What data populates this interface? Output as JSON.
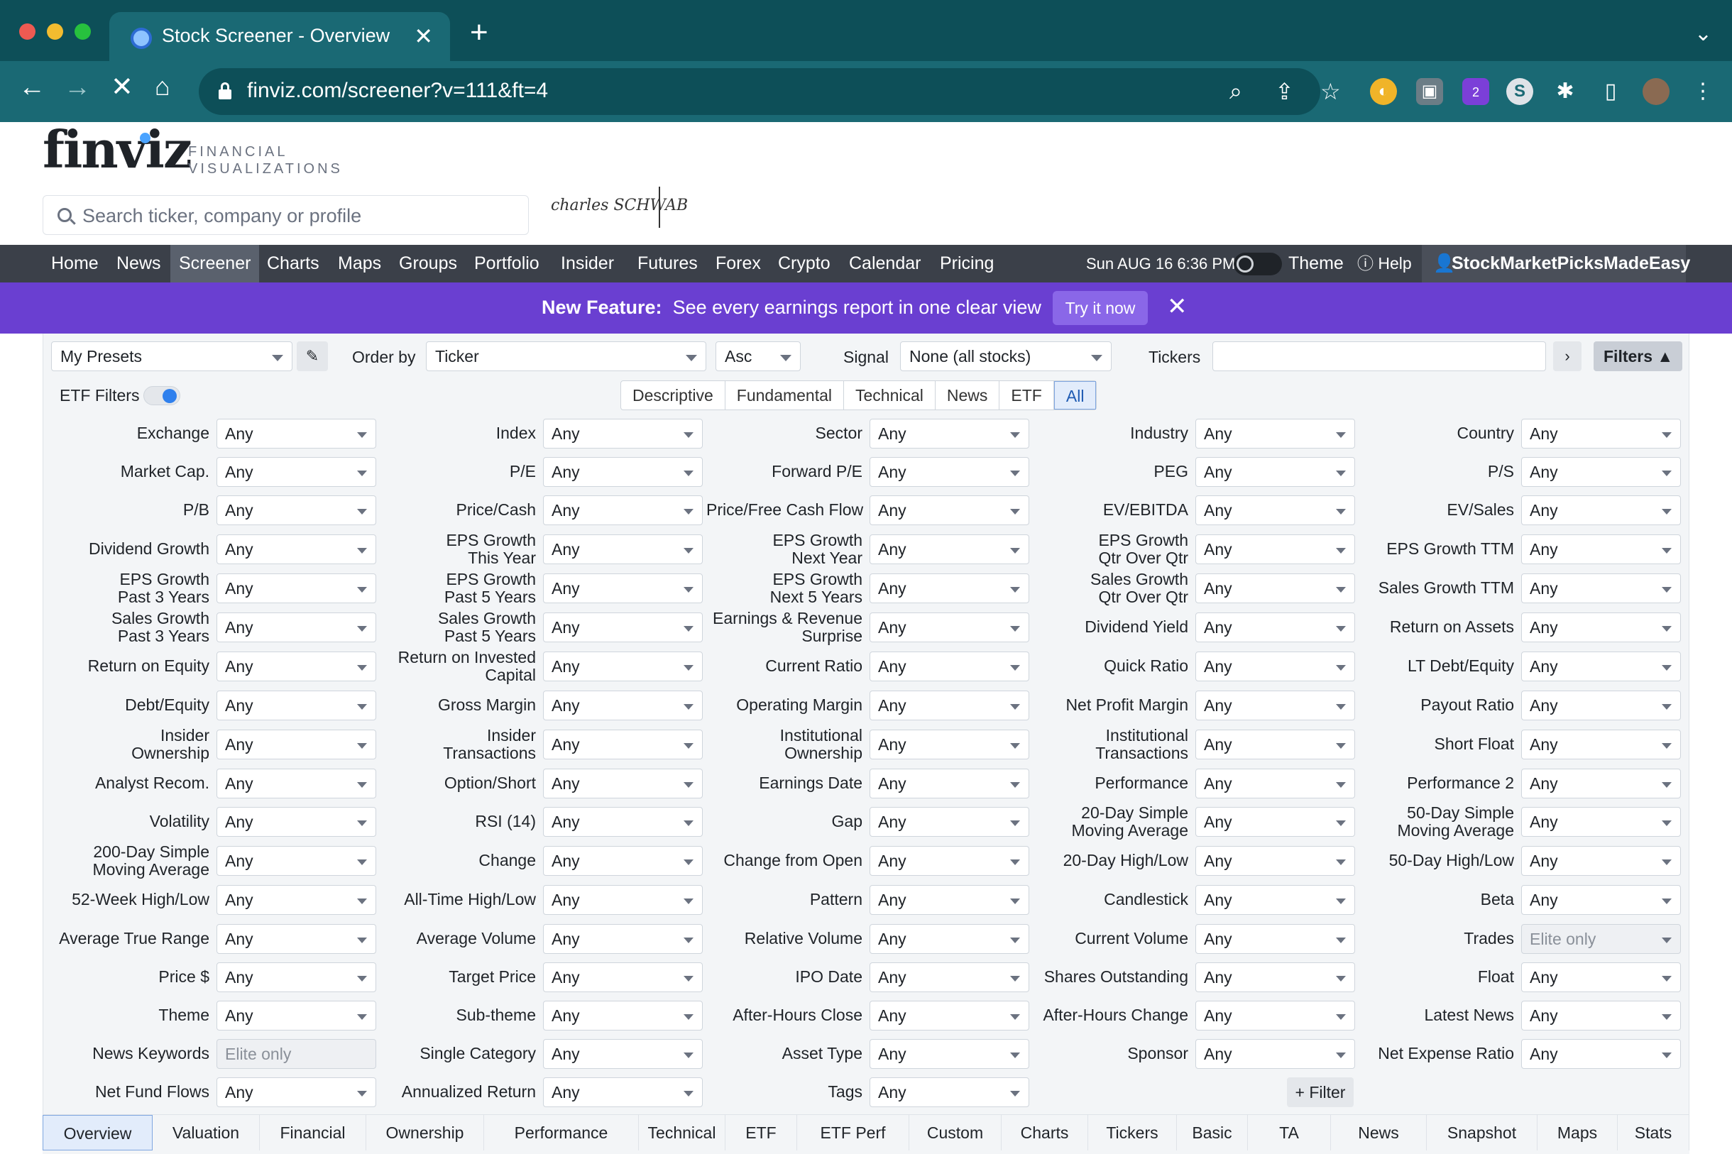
{
  "browser": {
    "tab_title": "Stock Screener - Overview",
    "url": "finviz.com/screener?v=111&ft=4",
    "ext_badge": "2"
  },
  "site": {
    "logo_text": "finviz",
    "logo_sub_line1": "FINANCIAL",
    "logo_sub_line2": "VISUALIZATIONS",
    "search_placeholder": "Search ticker, company or profile",
    "ad_text": "charles SCHWAB"
  },
  "nav": {
    "items": [
      "Home",
      "News",
      "Screener",
      "Charts",
      "Maps",
      "Groups",
      "Portfolio",
      "Insider",
      "Futures",
      "Forex",
      "Crypto",
      "Calendar",
      "Pricing"
    ],
    "active": "Screener",
    "date": "Sun AUG 16 6:36 PM",
    "theme": "Theme",
    "help": "Help",
    "user": "StockMarketPicksMadeEasy"
  },
  "banner": {
    "label": "New Feature:",
    "text": "See every earnings report in one clear view",
    "button": "Try it now"
  },
  "controls": {
    "presets": "My Presets",
    "order_by_label": "Order by",
    "order_by": "Ticker",
    "direction": "Asc",
    "signal_label": "Signal",
    "signal": "None (all stocks)",
    "tickers_label": "Tickers",
    "tickers_value": "",
    "filters_button": "Filters",
    "etf_filters_label": "ETF Filters",
    "etf_filters_on": true,
    "category_tabs": [
      "Descriptive",
      "Fundamental",
      "Technical",
      "News",
      "ETF",
      "All"
    ],
    "active_category": "All"
  },
  "filters": [
    {
      "label": "Exchange",
      "value": "Any"
    },
    {
      "label": "Index",
      "value": "Any"
    },
    {
      "label": "Sector",
      "value": "Any"
    },
    {
      "label": "Industry",
      "value": "Any"
    },
    {
      "label": "Country",
      "value": "Any"
    },
    {
      "label": "Market Cap.",
      "value": "Any"
    },
    {
      "label": "P/E",
      "value": "Any"
    },
    {
      "label": "Forward P/E",
      "value": "Any"
    },
    {
      "label": "PEG",
      "value": "Any"
    },
    {
      "label": "P/S",
      "value": "Any"
    },
    {
      "label": "P/B",
      "value": "Any"
    },
    {
      "label": "Price/Cash",
      "value": "Any"
    },
    {
      "label": "Price/Free Cash Flow",
      "value": "Any"
    },
    {
      "label": "EV/EBITDA",
      "value": "Any"
    },
    {
      "label": "EV/Sales",
      "value": "Any"
    },
    {
      "label": "Dividend Growth",
      "value": "Any"
    },
    {
      "label": "EPS Growth\nThis Year",
      "value": "Any"
    },
    {
      "label": "EPS Growth\nNext Year",
      "value": "Any"
    },
    {
      "label": "EPS Growth\nQtr Over Qtr",
      "value": "Any"
    },
    {
      "label": "EPS Growth TTM",
      "value": "Any"
    },
    {
      "label": "EPS Growth\nPast 3 Years",
      "value": "Any"
    },
    {
      "label": "EPS Growth\nPast 5 Years",
      "value": "Any"
    },
    {
      "label": "EPS Growth\nNext 5 Years",
      "value": "Any"
    },
    {
      "label": "Sales Growth\nQtr Over Qtr",
      "value": "Any"
    },
    {
      "label": "Sales Growth TTM",
      "value": "Any"
    },
    {
      "label": "Sales Growth\nPast 3 Years",
      "value": "Any"
    },
    {
      "label": "Sales Growth\nPast 5 Years",
      "value": "Any"
    },
    {
      "label": "Earnings & Revenue\nSurprise",
      "value": "Any"
    },
    {
      "label": "Dividend Yield",
      "value": "Any"
    },
    {
      "label": "Return on Assets",
      "value": "Any"
    },
    {
      "label": "Return on Equity",
      "value": "Any"
    },
    {
      "label": "Return on Invested\nCapital",
      "value": "Any"
    },
    {
      "label": "Current Ratio",
      "value": "Any"
    },
    {
      "label": "Quick Ratio",
      "value": "Any"
    },
    {
      "label": "LT Debt/Equity",
      "value": "Any"
    },
    {
      "label": "Debt/Equity",
      "value": "Any"
    },
    {
      "label": "Gross Margin",
      "value": "Any"
    },
    {
      "label": "Operating Margin",
      "value": "Any"
    },
    {
      "label": "Net Profit Margin",
      "value": "Any"
    },
    {
      "label": "Payout Ratio",
      "value": "Any"
    },
    {
      "label": "Insider\nOwnership",
      "value": "Any"
    },
    {
      "label": "Insider\nTransactions",
      "value": "Any"
    },
    {
      "label": "Institutional\nOwnership",
      "value": "Any"
    },
    {
      "label": "Institutional\nTransactions",
      "value": "Any"
    },
    {
      "label": "Short Float",
      "value": "Any"
    },
    {
      "label": "Analyst Recom.",
      "value": "Any"
    },
    {
      "label": "Option/Short",
      "value": "Any"
    },
    {
      "label": "Earnings Date",
      "value": "Any"
    },
    {
      "label": "Performance",
      "value": "Any"
    },
    {
      "label": "Performance 2",
      "value": "Any"
    },
    {
      "label": "Volatility",
      "value": "Any"
    },
    {
      "label": "RSI (14)",
      "value": "Any"
    },
    {
      "label": "Gap",
      "value": "Any"
    },
    {
      "label": "20-Day Simple\nMoving Average",
      "value": "Any"
    },
    {
      "label": "50-Day Simple\nMoving Average",
      "value": "Any"
    },
    {
      "label": "200-Day Simple\nMoving Average",
      "value": "Any"
    },
    {
      "label": "Change",
      "value": "Any"
    },
    {
      "label": "Change from Open",
      "value": "Any"
    },
    {
      "label": "20-Day High/Low",
      "value": "Any"
    },
    {
      "label": "50-Day High/Low",
      "value": "Any"
    },
    {
      "label": "52-Week High/Low",
      "value": "Any"
    },
    {
      "label": "All-Time High/Low",
      "value": "Any"
    },
    {
      "label": "Pattern",
      "value": "Any"
    },
    {
      "label": "Candlestick",
      "value": "Any"
    },
    {
      "label": "Beta",
      "value": "Any"
    },
    {
      "label": "Average True Range",
      "value": "Any"
    },
    {
      "label": "Average Volume",
      "value": "Any"
    },
    {
      "label": "Relative Volume",
      "value": "Any"
    },
    {
      "label": "Current Volume",
      "value": "Any"
    },
    {
      "label": "Trades",
      "value": "Elite only",
      "disabled": true
    },
    {
      "label": "Price $",
      "value": "Any"
    },
    {
      "label": "Target Price",
      "value": "Any"
    },
    {
      "label": "IPO Date",
      "value": "Any"
    },
    {
      "label": "Shares Outstanding",
      "value": "Any"
    },
    {
      "label": "Float",
      "value": "Any"
    },
    {
      "label": "Theme",
      "value": "Any"
    },
    {
      "label": "Sub-theme",
      "value": "Any"
    },
    {
      "label": "After-Hours Close",
      "value": "Any"
    },
    {
      "label": "After-Hours Change",
      "value": "Any"
    },
    {
      "label": "Latest News",
      "value": "Any"
    },
    {
      "label": "News Keywords",
      "value": "Elite only",
      "disabled": true
    },
    {
      "label": "Single Category",
      "value": "Any"
    },
    {
      "label": "Asset Type",
      "value": "Any"
    },
    {
      "label": "Sponsor",
      "value": "Any"
    },
    {
      "label": "Net Expense Ratio",
      "value": "Any"
    },
    {
      "label": "Net Fund Flows",
      "value": "Any"
    },
    {
      "label": "Annualized Return",
      "value": "Any"
    },
    {
      "label": "Tags",
      "value": "Any"
    }
  ],
  "add_filter_label": "+ Filter",
  "bottom_tabs": [
    "Overview",
    "Valuation",
    "Financial",
    "Ownership",
    "Performance",
    "Technical",
    "ETF",
    "ETF Perf",
    "Custom",
    "Charts",
    "Tickers",
    "Basic",
    "TA",
    "News",
    "Snapshot",
    "Maps",
    "Stats"
  ],
  "active_bottom_tab": "Overview",
  "colors": {
    "tabbar": "#0d4f58",
    "toolbar": "#1a6974",
    "nav": "#3b4049",
    "banner": "#6a3fd1",
    "panel": "#f3f5f7",
    "accent": "#2f80ed"
  }
}
